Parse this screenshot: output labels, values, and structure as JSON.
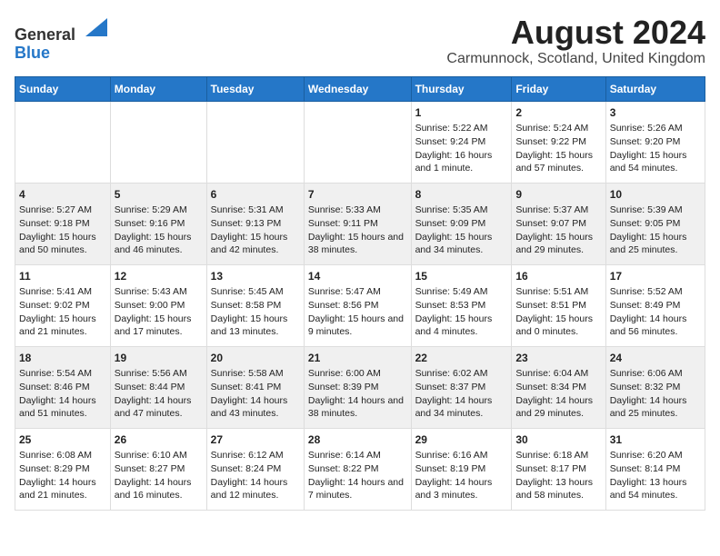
{
  "header": {
    "logo_general": "General",
    "logo_blue": "Blue",
    "title": "August 2024",
    "subtitle": "Carmunnock, Scotland, United Kingdom"
  },
  "calendar": {
    "days_of_week": [
      "Sunday",
      "Monday",
      "Tuesday",
      "Wednesday",
      "Thursday",
      "Friday",
      "Saturday"
    ],
    "weeks": [
      {
        "days": [
          {
            "num": "",
            "content": ""
          },
          {
            "num": "",
            "content": ""
          },
          {
            "num": "",
            "content": ""
          },
          {
            "num": "",
            "content": ""
          },
          {
            "num": "1",
            "content": "Sunrise: 5:22 AM\nSunset: 9:24 PM\nDaylight: 16 hours and 1 minute."
          },
          {
            "num": "2",
            "content": "Sunrise: 5:24 AM\nSunset: 9:22 PM\nDaylight: 15 hours and 57 minutes."
          },
          {
            "num": "3",
            "content": "Sunrise: 5:26 AM\nSunset: 9:20 PM\nDaylight: 15 hours and 54 minutes."
          }
        ]
      },
      {
        "days": [
          {
            "num": "4",
            "content": "Sunrise: 5:27 AM\nSunset: 9:18 PM\nDaylight: 15 hours and 50 minutes."
          },
          {
            "num": "5",
            "content": "Sunrise: 5:29 AM\nSunset: 9:16 PM\nDaylight: 15 hours and 46 minutes."
          },
          {
            "num": "6",
            "content": "Sunrise: 5:31 AM\nSunset: 9:13 PM\nDaylight: 15 hours and 42 minutes."
          },
          {
            "num": "7",
            "content": "Sunrise: 5:33 AM\nSunset: 9:11 PM\nDaylight: 15 hours and 38 minutes."
          },
          {
            "num": "8",
            "content": "Sunrise: 5:35 AM\nSunset: 9:09 PM\nDaylight: 15 hours and 34 minutes."
          },
          {
            "num": "9",
            "content": "Sunrise: 5:37 AM\nSunset: 9:07 PM\nDaylight: 15 hours and 29 minutes."
          },
          {
            "num": "10",
            "content": "Sunrise: 5:39 AM\nSunset: 9:05 PM\nDaylight: 15 hours and 25 minutes."
          }
        ]
      },
      {
        "days": [
          {
            "num": "11",
            "content": "Sunrise: 5:41 AM\nSunset: 9:02 PM\nDaylight: 15 hours and 21 minutes."
          },
          {
            "num": "12",
            "content": "Sunrise: 5:43 AM\nSunset: 9:00 PM\nDaylight: 15 hours and 17 minutes."
          },
          {
            "num": "13",
            "content": "Sunrise: 5:45 AM\nSunset: 8:58 PM\nDaylight: 15 hours and 13 minutes."
          },
          {
            "num": "14",
            "content": "Sunrise: 5:47 AM\nSunset: 8:56 PM\nDaylight: 15 hours and 9 minutes."
          },
          {
            "num": "15",
            "content": "Sunrise: 5:49 AM\nSunset: 8:53 PM\nDaylight: 15 hours and 4 minutes."
          },
          {
            "num": "16",
            "content": "Sunrise: 5:51 AM\nSunset: 8:51 PM\nDaylight: 15 hours and 0 minutes."
          },
          {
            "num": "17",
            "content": "Sunrise: 5:52 AM\nSunset: 8:49 PM\nDaylight: 14 hours and 56 minutes."
          }
        ]
      },
      {
        "days": [
          {
            "num": "18",
            "content": "Sunrise: 5:54 AM\nSunset: 8:46 PM\nDaylight: 14 hours and 51 minutes."
          },
          {
            "num": "19",
            "content": "Sunrise: 5:56 AM\nSunset: 8:44 PM\nDaylight: 14 hours and 47 minutes."
          },
          {
            "num": "20",
            "content": "Sunrise: 5:58 AM\nSunset: 8:41 PM\nDaylight: 14 hours and 43 minutes."
          },
          {
            "num": "21",
            "content": "Sunrise: 6:00 AM\nSunset: 8:39 PM\nDaylight: 14 hours and 38 minutes."
          },
          {
            "num": "22",
            "content": "Sunrise: 6:02 AM\nSunset: 8:37 PM\nDaylight: 14 hours and 34 minutes."
          },
          {
            "num": "23",
            "content": "Sunrise: 6:04 AM\nSunset: 8:34 PM\nDaylight: 14 hours and 29 minutes."
          },
          {
            "num": "24",
            "content": "Sunrise: 6:06 AM\nSunset: 8:32 PM\nDaylight: 14 hours and 25 minutes."
          }
        ]
      },
      {
        "days": [
          {
            "num": "25",
            "content": "Sunrise: 6:08 AM\nSunset: 8:29 PM\nDaylight: 14 hours and 21 minutes."
          },
          {
            "num": "26",
            "content": "Sunrise: 6:10 AM\nSunset: 8:27 PM\nDaylight: 14 hours and 16 minutes."
          },
          {
            "num": "27",
            "content": "Sunrise: 6:12 AM\nSunset: 8:24 PM\nDaylight: 14 hours and 12 minutes."
          },
          {
            "num": "28",
            "content": "Sunrise: 6:14 AM\nSunset: 8:22 PM\nDaylight: 14 hours and 7 minutes."
          },
          {
            "num": "29",
            "content": "Sunrise: 6:16 AM\nSunset: 8:19 PM\nDaylight: 14 hours and 3 minutes."
          },
          {
            "num": "30",
            "content": "Sunrise: 6:18 AM\nSunset: 8:17 PM\nDaylight: 13 hours and 58 minutes."
          },
          {
            "num": "31",
            "content": "Sunrise: 6:20 AM\nSunset: 8:14 PM\nDaylight: 13 hours and 54 minutes."
          }
        ]
      }
    ]
  }
}
